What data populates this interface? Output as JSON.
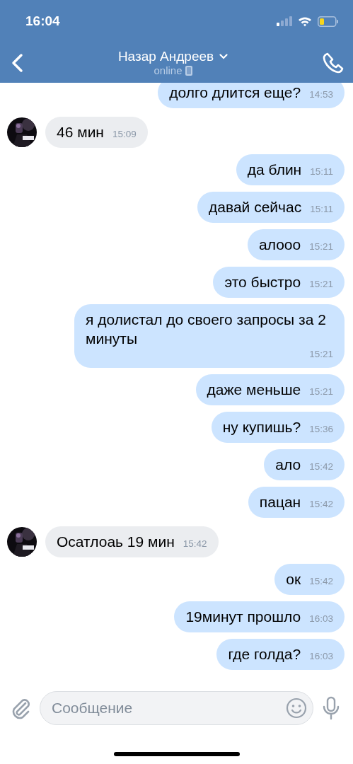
{
  "status_bar": {
    "time": "16:04"
  },
  "header": {
    "name": "Назар Андреев",
    "status": "online"
  },
  "messages": [
    {
      "kind": "outgoing",
      "text": "долго длится еще?",
      "time": "14:53"
    },
    {
      "kind": "incoming",
      "text": "46 мин",
      "time": "15:09"
    },
    {
      "kind": "outgoing",
      "text": "да блин",
      "time": "15:11"
    },
    {
      "kind": "outgoing",
      "text": "давай сейчас",
      "time": "15:11"
    },
    {
      "kind": "outgoing",
      "text": "алооо",
      "time": "15:21"
    },
    {
      "kind": "outgoing",
      "text": "это быстро",
      "time": "15:21"
    },
    {
      "kind": "outgoing",
      "text": "я долистал до своего запросы за 2 минуты",
      "time": "15:21"
    },
    {
      "kind": "outgoing",
      "text": "даже меньше",
      "time": "15:21"
    },
    {
      "kind": "outgoing",
      "text": "ну купишь?",
      "time": "15:36"
    },
    {
      "kind": "outgoing",
      "text": "ало",
      "time": "15:42"
    },
    {
      "kind": "outgoing",
      "text": "пацан",
      "time": "15:42"
    },
    {
      "kind": "incoming",
      "text": "Осатлоаь 19 мин",
      "time": "15:42"
    },
    {
      "kind": "outgoing",
      "text": "ок",
      "time": "15:42"
    },
    {
      "kind": "outgoing",
      "text": "19минут прошло",
      "time": "16:03"
    },
    {
      "kind": "outgoing",
      "text": "где голда?",
      "time": "16:03"
    }
  ],
  "composer": {
    "placeholder": "Сообщение"
  }
}
